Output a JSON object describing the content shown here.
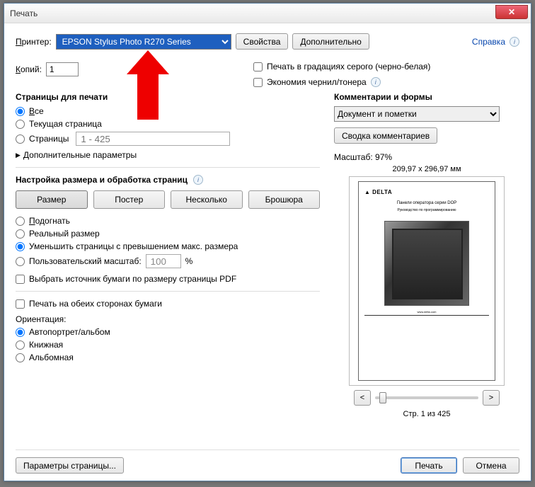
{
  "window": {
    "title": "Печать"
  },
  "top": {
    "printer_label": "Принтер:",
    "printer_value": "EPSON Stylus Photo R270 Series",
    "properties_btn": "Свойства",
    "advanced_btn": "Дополнительно",
    "help_link": "Справка"
  },
  "copies": {
    "label": "Копий:",
    "value": "1"
  },
  "right_checks": {
    "grayscale": "Печать в градациях серого (черно-белая)",
    "save_ink": "Экономия чернил/тонера"
  },
  "pages": {
    "title": "Страницы для печати",
    "all": "Все",
    "current": "Текущая страница",
    "pages": "Страницы",
    "range_placeholder": "1 - 425",
    "more": "Дополнительные параметры"
  },
  "sizing": {
    "title": "Настройка размера и обработка страниц",
    "size_btn": "Размер",
    "poster_btn": "Постер",
    "multiple_btn": "Несколько",
    "booklet_btn": "Брошюра",
    "fit": "Подогнать",
    "actual": "Реальный размер",
    "shrink": "Уменьшить страницы с превышением макс. размера",
    "custom": "Пользовательский масштаб:",
    "custom_value": "100",
    "percent": "%",
    "choose_source": "Выбрать источник бумаги по размеру страницы PDF",
    "duplex": "Печать на обеих сторонах бумаги",
    "orientation": "Ориентация:",
    "orient_auto": "Автопортрет/альбом",
    "orient_portrait": "Книжная",
    "orient_land": "Альбомная"
  },
  "comments": {
    "title": "Комментарии и формы",
    "combo": "Документ и пометки",
    "summary_btn": "Сводка комментариев"
  },
  "preview": {
    "scale_label": "Масштаб:",
    "scale_value": "97%",
    "dims": "209,97 x 296,97 мм",
    "doc_brand": "▲ DELTA",
    "doc_title": "Панели оператора серии DOP",
    "doc_sub": "Руководство по программированию",
    "prev": "<",
    "next": ">",
    "page_of": "Стр. 1 из 425"
  },
  "footer": {
    "page_setup": "Параметры страницы...",
    "print": "Печать",
    "cancel": "Отмена"
  }
}
